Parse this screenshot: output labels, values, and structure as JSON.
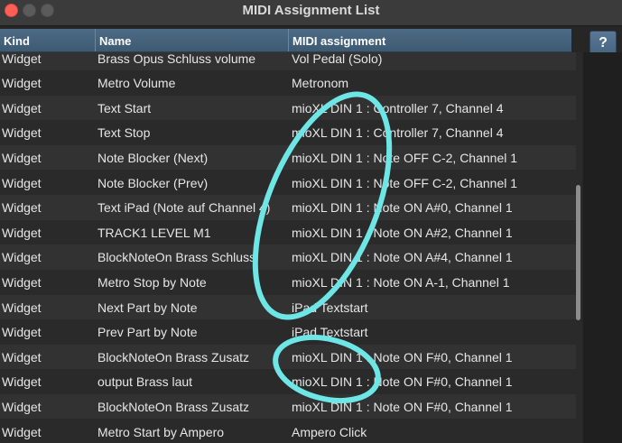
{
  "window": {
    "title": "MIDI Assignment List",
    "help_label": "?"
  },
  "columns": {
    "kind": "Kind",
    "name": "Name",
    "midi": "MIDI assignment"
  },
  "rows": [
    {
      "kind": "Widget",
      "name": "Brass Opus Schluss volume",
      "midi": "Vol Pedal (Solo)"
    },
    {
      "kind": "Widget",
      "name": "Metro Volume",
      "midi": "Metronom"
    },
    {
      "kind": "Widget",
      "name": "Text Start",
      "midi": "mioXL DIN 1 : Controller 7, Channel 4"
    },
    {
      "kind": "Widget",
      "name": "Text Stop",
      "midi": "mioXL DIN 1 : Controller 7, Channel 4"
    },
    {
      "kind": "Widget",
      "name": "Note Blocker (Next)",
      "midi": "mioXL DIN 1 : Note OFF C-2, Channel 1"
    },
    {
      "kind": "Widget",
      "name": "Note Blocker (Prev)",
      "midi": "mioXL DIN 1 : Note OFF C-2, Channel 1"
    },
    {
      "kind": "Widget",
      "name": "Text iPad (Note auf Channel 4)",
      "midi": "mioXL DIN 1 : Note ON A#0, Channel 1"
    },
    {
      "kind": "Widget",
      "name": "TRACK1 LEVEL M1",
      "midi": "mioXL DIN 1 : Note ON A#2, Channel 1"
    },
    {
      "kind": "Widget",
      "name": "BlockNoteOn Brass Schluss",
      "midi": "mioXL DIN 1 : Note ON A#4, Channel 1"
    },
    {
      "kind": "Widget",
      "name": "Metro Stop by Note",
      "midi": "mioXL DIN 1 : Note ON A-1, Channel 1"
    },
    {
      "kind": "Widget",
      "name": "Next Part by Note",
      "midi": "iPad Textstart"
    },
    {
      "kind": "Widget",
      "name": "Prev Part by Note",
      "midi": "iPad Textstart"
    },
    {
      "kind": "Widget",
      "name": "BlockNoteOn Brass Zusatz",
      "midi": "mioXL DIN 1 : Note ON F#0, Channel 1"
    },
    {
      "kind": "Widget",
      "name": "output Brass laut",
      "midi": "mioXL DIN 1 : Note ON F#0, Channel 1"
    },
    {
      "kind": "Widget",
      "name": "BlockNoteOn Brass Zusatz",
      "midi": "mioXL DIN 1 : Note ON F#0, Channel 1"
    },
    {
      "kind": "Widget",
      "name": "Metro Start by Ampero",
      "midi": "Ampero Click"
    }
  ],
  "colors": {
    "header_bg": "#46627b",
    "annotation": "#6ee6e6",
    "close": "#ff5f57"
  }
}
